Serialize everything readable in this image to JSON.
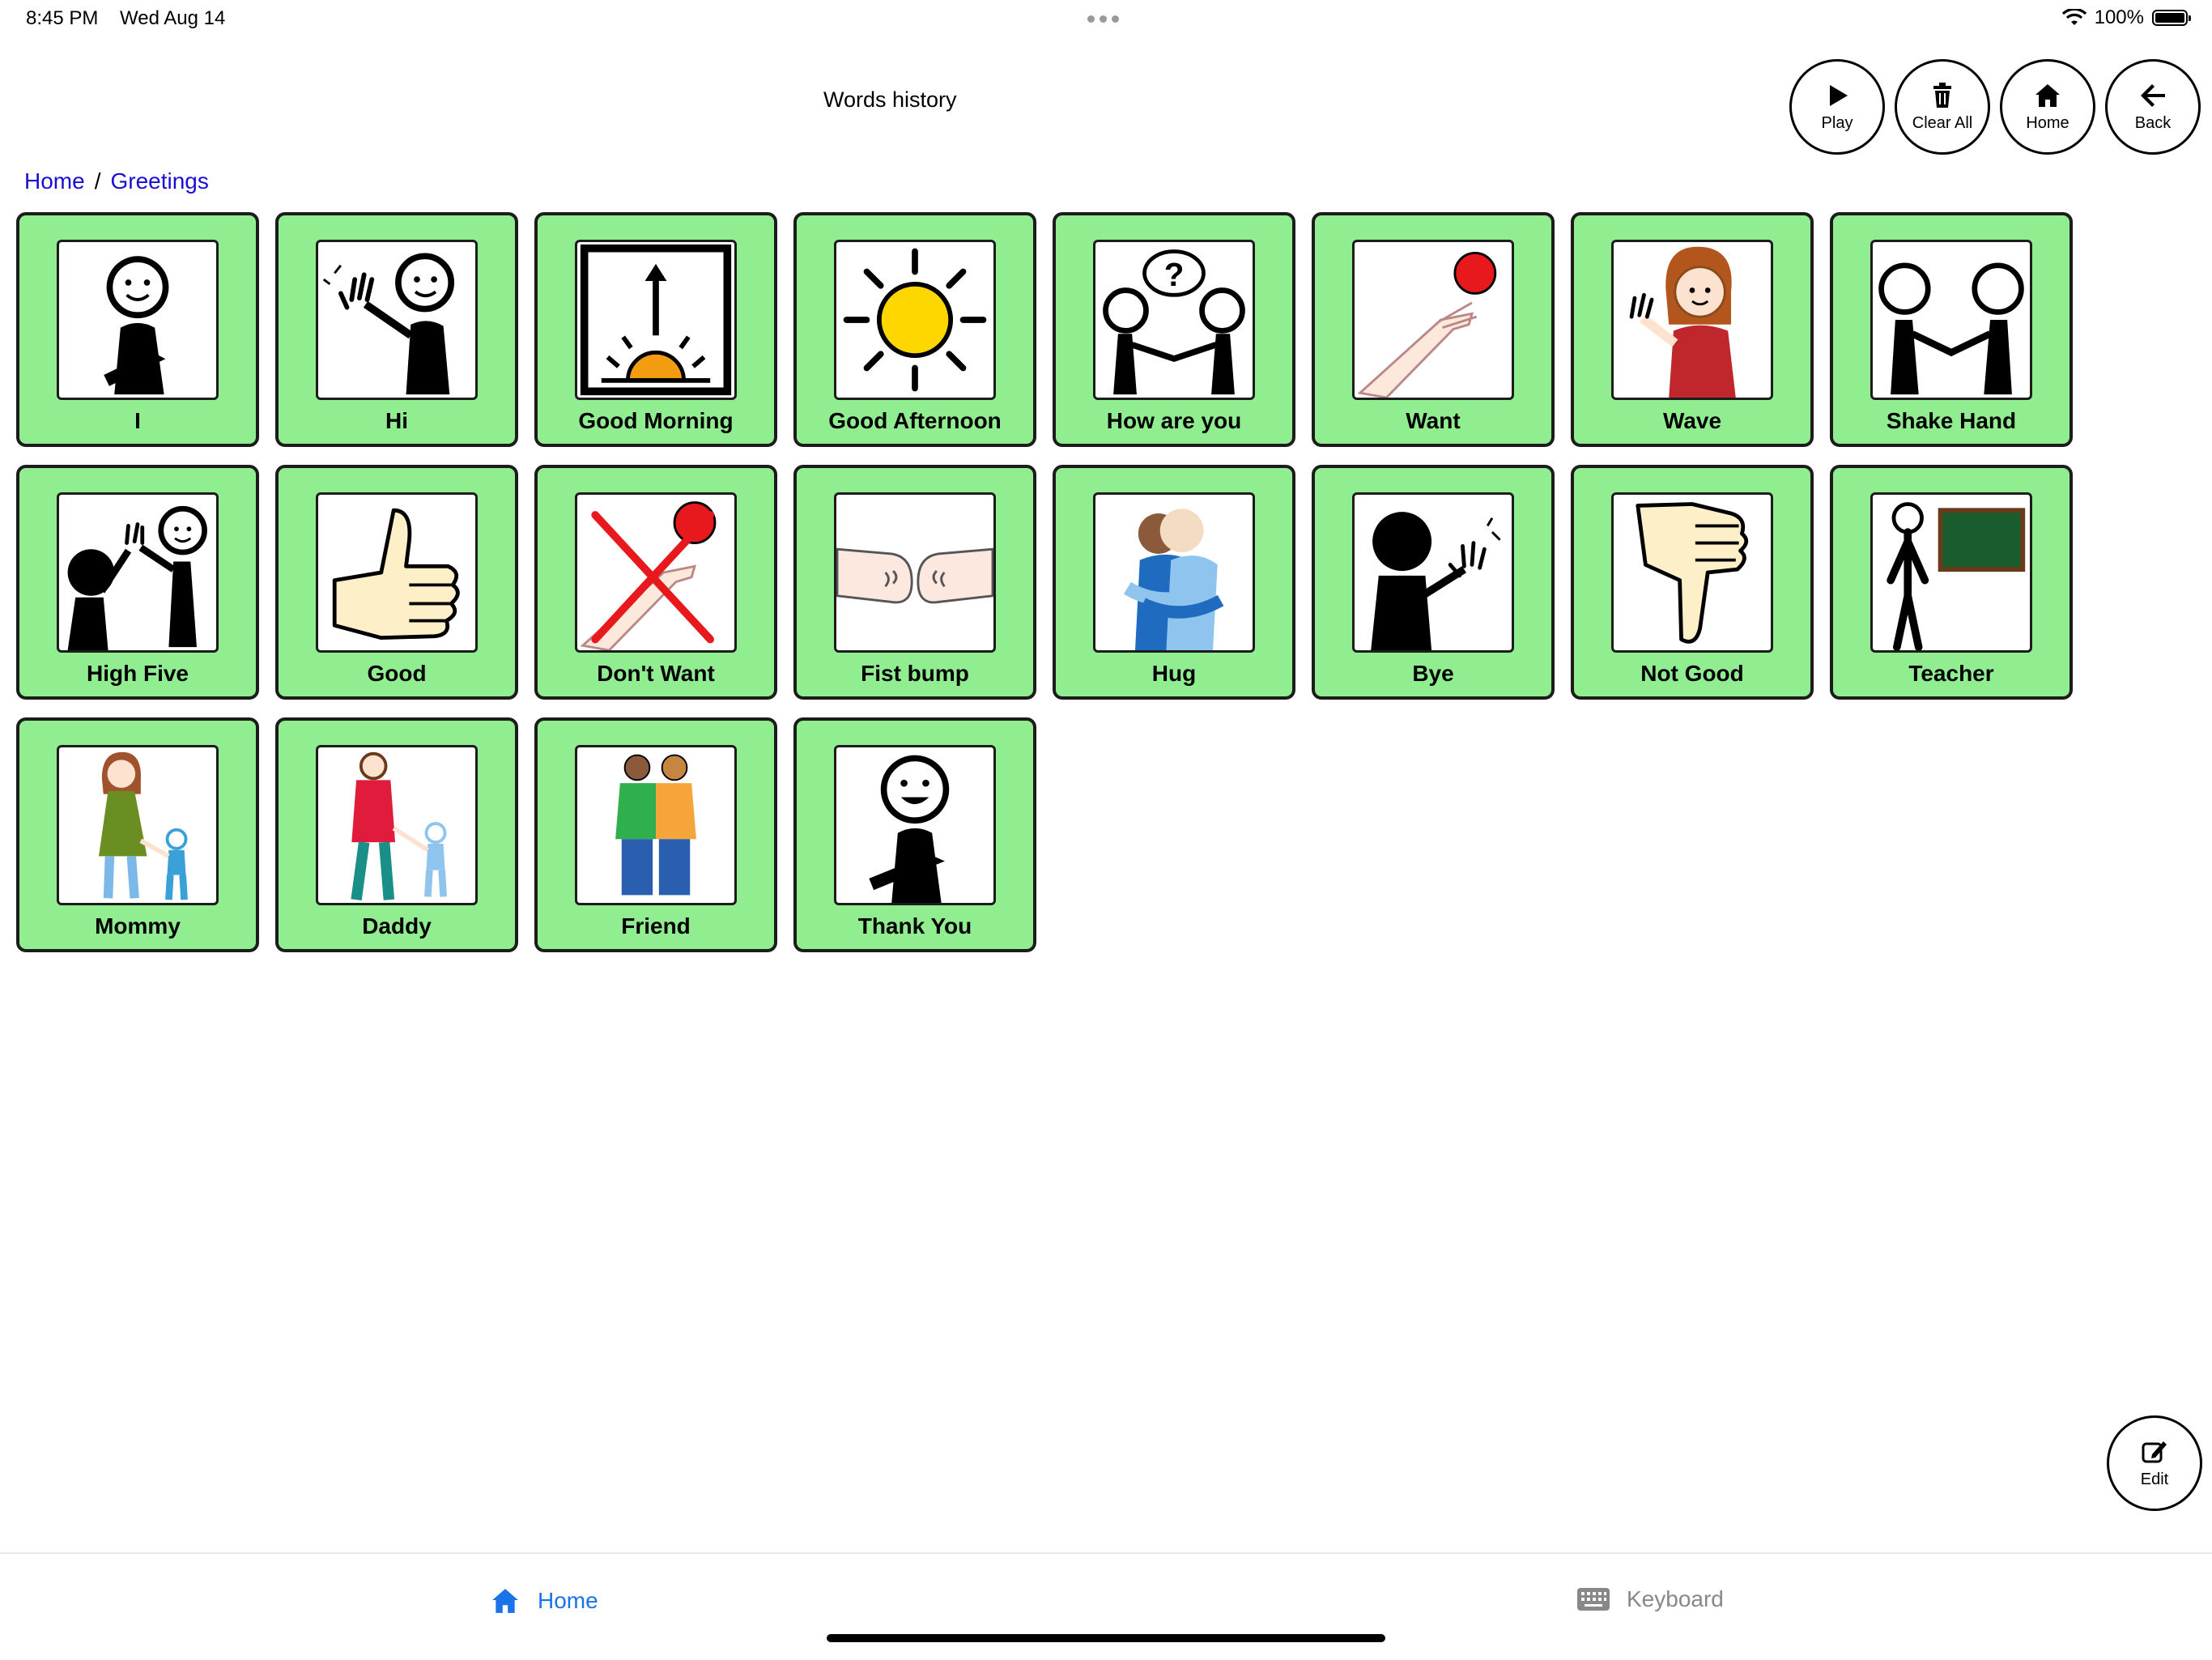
{
  "status_bar": {
    "time": "8:45 PM",
    "date": "Wed Aug 14",
    "battery": "100%",
    "battery_level": 1.0
  },
  "header": {
    "title": "Words history",
    "buttons": [
      {
        "label": "Play",
        "icon": "play-icon"
      },
      {
        "label": "Clear All",
        "icon": "trash-icon"
      },
      {
        "label": "Home",
        "icon": "home-icon"
      },
      {
        "label": "Back",
        "icon": "back-arrow-icon"
      }
    ]
  },
  "breadcrumb": {
    "items": [
      "Home",
      "Greetings"
    ],
    "separator": "/"
  },
  "tiles": [
    {
      "label": "I",
      "icon": "person-self-icon"
    },
    {
      "label": "Hi",
      "icon": "person-waving-icon"
    },
    {
      "label": "Good Morning",
      "icon": "sunrise-icon"
    },
    {
      "label": "Good Afternoon",
      "icon": "sun-icon"
    },
    {
      "label": "How are you",
      "icon": "two-people-question-icon"
    },
    {
      "label": "Want",
      "icon": "hand-reaching-ball-icon"
    },
    {
      "label": "Wave",
      "icon": "girl-waving-icon"
    },
    {
      "label": "Shake Hand",
      "icon": "handshake-icon"
    },
    {
      "label": "High Five",
      "icon": "high-five-icon"
    },
    {
      "label": "Good",
      "icon": "thumbs-up-icon"
    },
    {
      "label": "Don't Want",
      "icon": "crossed-reach-icon"
    },
    {
      "label": "Fist bump",
      "icon": "fist-bump-icon"
    },
    {
      "label": "Hug",
      "icon": "hug-icon"
    },
    {
      "label": "Bye",
      "icon": "person-bye-icon"
    },
    {
      "label": "Not Good",
      "icon": "thumbs-down-icon"
    },
    {
      "label": "Teacher",
      "icon": "teacher-blackboard-icon"
    },
    {
      "label": "Mommy",
      "icon": "mother-child-icon"
    },
    {
      "label": "Daddy",
      "icon": "father-child-icon"
    },
    {
      "label": "Friend",
      "icon": "two-friends-icon"
    },
    {
      "label": "Thank You",
      "icon": "person-thank-you-icon"
    }
  ],
  "edit_button": {
    "label": "Edit",
    "icon": "edit-icon"
  },
  "tab_bar": {
    "tabs": [
      {
        "label": "Home",
        "icon": "home-icon",
        "active": true
      },
      {
        "label": "Keyboard",
        "icon": "keyboard-icon",
        "active": false
      }
    ]
  },
  "colors": {
    "tile_bg": "#90ee90",
    "link": "#1a0dd6",
    "active_tab": "#1a73e8",
    "inactive_tab": "#888888"
  }
}
